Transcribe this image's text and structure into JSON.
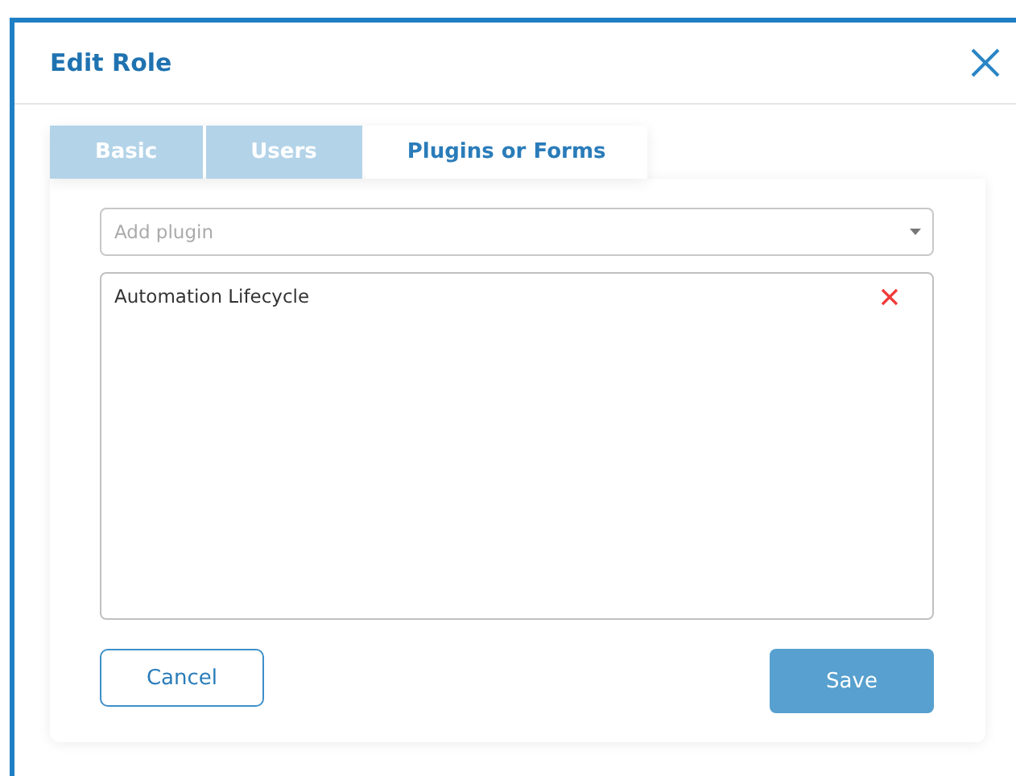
{
  "dialog": {
    "title": "Edit Role"
  },
  "tabs": [
    {
      "label": "Basic",
      "selected": false
    },
    {
      "label": "Users",
      "selected": false
    },
    {
      "label": "Plugins or Forms",
      "selected": true
    }
  ],
  "plugin_select": {
    "placeholder": "Add plugin"
  },
  "plugins": [
    {
      "name": "Automation Lifecycle"
    }
  ],
  "buttons": {
    "cancel": "Cancel",
    "save": "Save"
  }
}
